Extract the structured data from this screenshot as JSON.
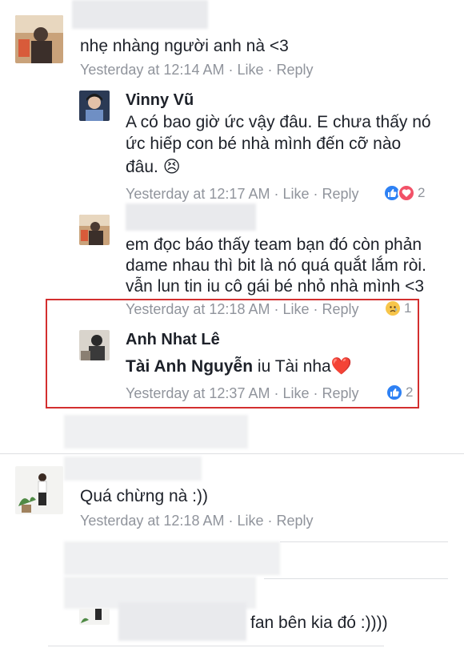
{
  "colors": {
    "meta": "#90949c",
    "text": "#1d2129",
    "like_blue": "#2e81f4",
    "love_red": "#f25268",
    "highlight_red": "#d32f2f"
  },
  "comments": [
    {
      "text": "nhẹ nhàng người anh nà <3",
      "meta": {
        "time": "Yesterday at 12:14 AM",
        "like": "Like",
        "reply": "Reply"
      }
    },
    {
      "author": "Vinny Vũ",
      "text_line1": "A có bao giờ ức vậy đâu. E chưa thấy nó",
      "text_line2": "ức hiếp con bé nhà mình đến cỡ nào",
      "text_line3": "đâu.",
      "emoji": "😣",
      "meta": {
        "time": "Yesterday at 12:17 AM",
        "like": "Like",
        "reply": "Reply"
      },
      "reactions": {
        "icons": [
          "like-icon",
          "love-icon"
        ],
        "count": "2"
      }
    },
    {
      "text_line1": "em đọc báo thấy team bạn đó còn phản",
      "text_line2": "dame nhau thì bit là nó quá quắt lắm ròi.",
      "text_line3": "vẫn lun tin iu cô gái bé nhỏ nhà mình <3",
      "meta": {
        "time": "Yesterday at 12:18 AM",
        "like": "Like",
        "reply": "Reply"
      },
      "reactions": {
        "icons": [
          "sad-icon"
        ],
        "count": "1"
      }
    },
    {
      "author": "Anh Nhat Lê",
      "mention": "Tài Anh Nguyễn",
      "text": " iu Tài nha",
      "emoji": "❤️",
      "meta": {
        "time": "Yesterday at 12:37 AM",
        "like": "Like",
        "reply": "Reply"
      },
      "reactions": {
        "icons": [
          "like-icon"
        ],
        "count": "2"
      }
    },
    {
      "text": "Quá chừng nà :))",
      "meta": {
        "time": "Yesterday at 12:18 AM",
        "like": "Like",
        "reply": "Reply"
      }
    },
    {
      "text": "fan bên kia đó :))))"
    }
  ],
  "separator": "·"
}
